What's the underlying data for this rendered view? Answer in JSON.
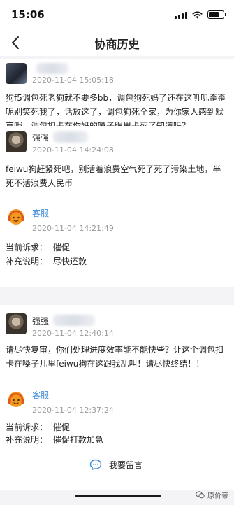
{
  "status_bar": {
    "time": "15:06",
    "battery_level": 0.7
  },
  "nav": {
    "title": "协商历史"
  },
  "messages": [
    {
      "sender": "",
      "time": "2020-11-04 15:05:18",
      "text": "狗f5调包死老狗就不要多bb，调包狗死妈了还在这叽叽歪歪呢别笑死我了，话放这了，调包狗死全家，为你家人感到默哀哦，调包扣卡在你妈的嗓子眼里卡死了知道吗？"
    },
    {
      "sender": "强强",
      "time": "2020-11-04 14:24:08",
      "text": "feiwu狗赶紧死吧，别活着浪费空气死了死了污染土地，半死不活浪费人民币"
    },
    {
      "sender": "客服",
      "time": "2020-11-04 14:21:49",
      "appeal_label": "当前诉求：",
      "appeal_value": "催促",
      "note_label": "补充说明：",
      "note_value": "尽快还款"
    },
    {
      "sender": "强强",
      "time": "2020-11-04 12:40:14",
      "text": "请尽快复审，你们处理进度效率能不能快些？让这个调包扣卡在嗓子儿里feiwu狗在这跟我乱叫！请尽快终结！！"
    },
    {
      "sender": "客服",
      "time": "2020-11-04 12:37:24",
      "appeal_label": "当前诉求：",
      "appeal_value": "催促",
      "note_label": "补充说明：",
      "note_value": "催促打款加急"
    }
  ],
  "actions": {
    "leave_message": "我要留言"
  },
  "watermark": {
    "text": "原价帝"
  },
  "colors": {
    "accent": "#3c8ad8",
    "service_orange": "#f39a1e"
  }
}
